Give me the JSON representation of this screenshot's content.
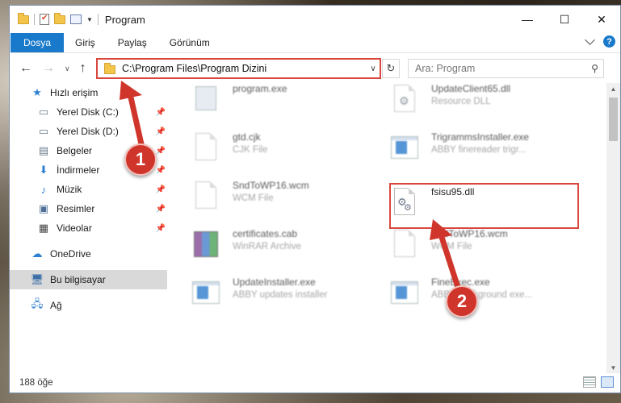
{
  "window": {
    "title": "Program",
    "controls": {
      "minimize": "—",
      "maximize": "☐",
      "close": "✕"
    }
  },
  "ribbon": {
    "tabs": [
      "Dosya",
      "Giriş",
      "Paylaş",
      "Görünüm"
    ]
  },
  "address": {
    "path": "C:\\Program Files\\Program Dizini",
    "search_placeholder": "Ara: Program"
  },
  "sidebar": {
    "items": [
      {
        "label": "Hızlı erişim",
        "icon": "star-icon",
        "pinned": false
      },
      {
        "label": "Yerel Disk (C:)",
        "icon": "drive-icon",
        "pinned": true
      },
      {
        "label": "Yerel Disk (D:)",
        "icon": "drive-icon",
        "pinned": true
      },
      {
        "label": "Belgeler",
        "icon": "document-icon",
        "pinned": true
      },
      {
        "label": "İndirmeler",
        "icon": "download-icon",
        "pinned": true
      },
      {
        "label": "Müzik",
        "icon": "music-icon",
        "pinned": true
      },
      {
        "label": "Resimler",
        "icon": "pictures-icon",
        "pinned": true
      },
      {
        "label": "Videolar",
        "icon": "video-icon",
        "pinned": true
      },
      {
        "label": "OneDrive",
        "icon": "cloud-icon",
        "pinned": false
      },
      {
        "label": "Bu bilgisayar",
        "icon": "computer-icon",
        "pinned": false,
        "selected": true
      },
      {
        "label": "Ağ",
        "icon": "network-icon",
        "pinned": false
      }
    ]
  },
  "files": [
    {
      "name": "program.exe",
      "type": "",
      "icon": "setup-icon"
    },
    {
      "name": "UpdateClient65.dll",
      "type": "Resource DLL",
      "icon": "dll-icon"
    },
    {
      "name": "gtd.cjk",
      "type": "CJK File",
      "icon": "file-icon"
    },
    {
      "name": "TrigrammsInstaller.exe",
      "type": "ABBY finereader trigr...",
      "icon": "exe-icon"
    },
    {
      "name": "SndToWP16.wcm",
      "type": "WCM File",
      "icon": "file-icon"
    },
    {
      "name": "fsisu95.dll",
      "type": "",
      "icon": "dll-gear-icon",
      "highlighted": true
    },
    {
      "name": "certificates.cab",
      "type": "WinRAR Archive",
      "icon": "rar-icon"
    },
    {
      "name": "SndToWP16.wcm",
      "type": "WCM File",
      "icon": "file-icon"
    },
    {
      "name": "UpdateInstaller.exe",
      "type": "ABBY updates installer",
      "icon": "exe-icon"
    },
    {
      "name": "FineExec.exe",
      "type": "ABBY background exe...",
      "icon": "exe-icon"
    }
  ],
  "status": {
    "item_count": "188 öğe"
  },
  "callouts": [
    "1",
    "2"
  ],
  "colors": {
    "accent": "#1979ca",
    "highlight": "#d9473e",
    "callout": "#d0352b"
  }
}
